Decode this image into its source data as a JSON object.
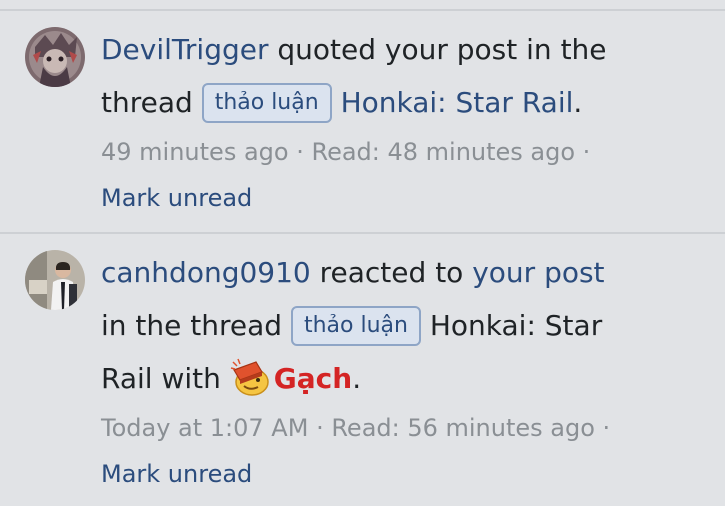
{
  "notifications": [
    {
      "username": "DevilTrigger",
      "action_text": " quoted your post in the",
      "line2_prefix": "thread ",
      "tag": "thảo luận",
      "thread_title": " Honkai: Star Rail",
      "line2_suffix": ".",
      "time": "49 minutes ago",
      "read": " · Read: 48 minutes ago ·",
      "mark_unread": "Mark unread"
    },
    {
      "username": "canhdong0910",
      "action_text": " reacted to ",
      "post_link": "your post",
      "line2_prefix": "in the thread ",
      "tag": "thảo luận",
      "thread_title_part1": " Honkai: Star",
      "thread_title_part2": "Rail",
      "line3_with": " with ",
      "reaction_icon": "gach-brick-icon",
      "reaction_name": "Gạch",
      "line3_suffix": ".",
      "time": "Today at 1:07 AM",
      "read": " · Read: 56 minutes ago ·",
      "mark_unread": "Mark unread"
    }
  ],
  "colors": {
    "background": "#e1e3e6",
    "link": "#2b4c7d",
    "meta": "#8a8f94",
    "reaction": "#d42424",
    "tag_border": "#8ea5c6",
    "tag_bg": "#dbe3ef"
  }
}
